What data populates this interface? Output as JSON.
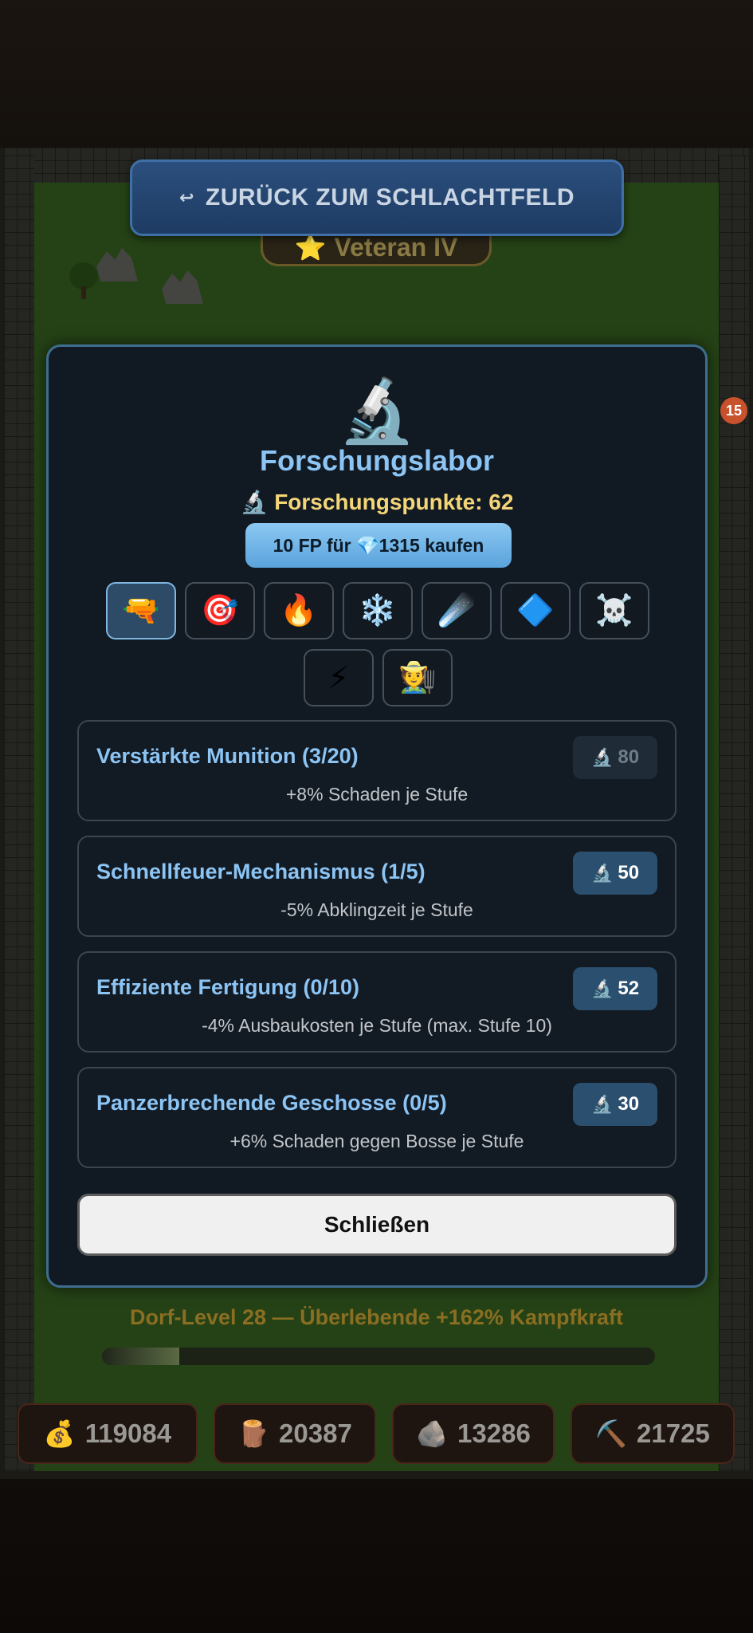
{
  "header": {
    "back_button_label": "ZURÜCK ZUM SCHLACHTFELD",
    "back_icon": "↩",
    "rank_icon": "⭐",
    "rank_label": "Veteran IV"
  },
  "notification_badge": "15",
  "research_lab": {
    "icon": "🔬",
    "title": "Forschungslabor",
    "points_icon": "🔬",
    "points_label": "Forschungspunkte: 62",
    "buy_button": "10 FP für 💎1315 kaufen",
    "tabs": [
      {
        "icon": "🔫",
        "active": true
      },
      {
        "icon": "🎯",
        "active": false
      },
      {
        "icon": "🔥",
        "active": false
      },
      {
        "icon": "❄️",
        "active": false
      },
      {
        "icon": "☄️",
        "active": false
      },
      {
        "icon": "🔷",
        "active": false
      },
      {
        "icon": "☠️",
        "active": false
      },
      {
        "icon": "⚡",
        "active": false
      },
      {
        "icon": "🧑‍🌾",
        "active": false
      }
    ],
    "upgrades": [
      {
        "title": "Verstärkte Munition (3/20)",
        "description": "+8% Schaden je Stufe",
        "cost": "80",
        "affordable": false
      },
      {
        "title": "Schnellfeuer-Mechanismus (1/5)",
        "description": "-5% Abklingzeit je Stufe",
        "cost": "50",
        "affordable": true
      },
      {
        "title": "Effiziente Fertigung (0/10)",
        "description": "-4% Ausbaukosten je Stufe (max. Stufe 10)",
        "cost": "52",
        "affordable": true
      },
      {
        "title": "Panzerbrechende Geschosse (0/5)",
        "description": "+6% Schaden gegen Bosse je Stufe",
        "cost": "30",
        "affordable": true
      }
    ],
    "cost_icon": "🔬",
    "close_button": "Schließen"
  },
  "village": {
    "label": "Dorf-Level 28 — Überlebende +162% Kampfkraft",
    "progress_fraction": 0.14
  },
  "resources": [
    {
      "icon": "💰",
      "value": "119084"
    },
    {
      "icon": "🪵",
      "value": "20387"
    },
    {
      "icon": "🪨",
      "value": "13286"
    },
    {
      "icon": "⛏️",
      "value": "21725"
    }
  ]
}
